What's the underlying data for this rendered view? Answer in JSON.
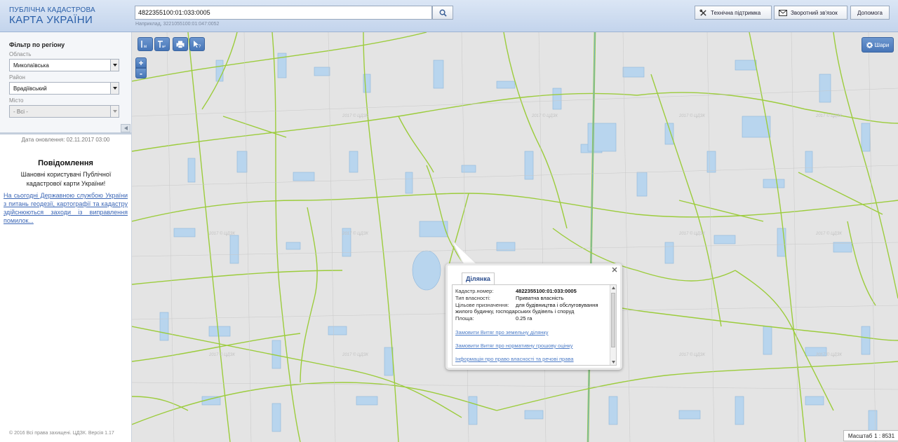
{
  "header": {
    "logo_line1": "ПУБЛІЧНА КАДАСТРОВА",
    "logo_line2": "КАРТА УКРАЇНИ",
    "search_value": "4822355100:01:033:0005",
    "search_hint": "Наприклад, 3221055100:01:047:0052",
    "buttons": {
      "support": "Технічна підтримка",
      "feedback": "Зворотний зв'язок",
      "help": "Допомога"
    }
  },
  "sidebar": {
    "filter_title": "Фільтр по регіону",
    "oblast_label": "Область",
    "oblast_value": "Миколаївська",
    "raion_label": "Район",
    "raion_value": "Врадіївський",
    "misto_label": "Місто",
    "misto_value": "- Всі -",
    "update_date": "Дата оновлення: 02.11.2017 03:00",
    "notice_title": "Повідомлення",
    "notice_text": "Шановні користувачі Публічної кадастрової карти України!",
    "notice_link": "На сьогодні Державною службою України з питань геодезії, картографії та кадастру здійснюються заходи із виправлення помилок...",
    "copyright": "© 2016 Всі права захищені. ЦДЗК. Версія 1.17"
  },
  "map": {
    "layers_label": "Шари",
    "zoom_in": "+",
    "zoom_out": "-",
    "scale_label": "Масштаб",
    "scale_value": "1 : 8531",
    "watermark": "2017 © ЦДЗК"
  },
  "popup": {
    "tab_label": "Ділянка",
    "cadastral_label": "Кадастр.номер:",
    "cadastral_value": "4822355100:01:033:0005",
    "ownership_label": "Тип власності:",
    "ownership_value": "Приватна власність",
    "purpose_label": "Цільове призначення:",
    "purpose_value": "для будівництва і обслуговування",
    "purpose_value_cont": "жилого будинку, господарських будівель і споруд",
    "area_label": "Площа:",
    "area_value": "0.25 га",
    "link1": "Замовити Витяг про земельну ділянку",
    "link2": "Замовити Витяг про нормативну грошову оцінку",
    "link3": "Інформація про право власності та речові права"
  }
}
